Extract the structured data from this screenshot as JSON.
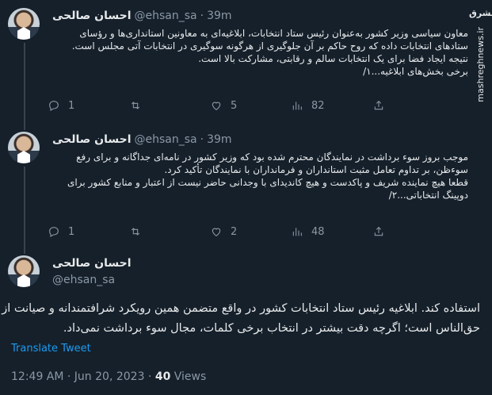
{
  "tweets": [
    {
      "name": "احسان صالحی",
      "handle": "@ehsan_sa",
      "dot": "·",
      "time": "39m",
      "lines": [
        "معاون سیاسی وزیر کشور به‌عنوان رئیس ستاد انتخابات، ابلاغیه‌ای به معاونین استانداری‌ها و رؤسای",
        "ستادهای انتخابات داده که روح حاکم بر آن جلوگیری از هرگونه سوگیری در انتخابات آتی مجلس است.",
        "نتیجه ایجاد فضا برای یک انتخابات سالم و رقابتی، مشارکت بالا است.",
        "برخی بخش‌های ابلاغیه...۱/"
      ],
      "replies": "1",
      "retweets": "",
      "likes": "5",
      "views": "82"
    },
    {
      "name": "احسان صالحی",
      "handle": "@ehsan_sa",
      "dot": "·",
      "time": "39m",
      "lines": [
        "موجب بروز سوء برداشت در نمایندگان محترم شده بود که وزیر کشور در نامه‌ای جداگانه و برای رفع",
        "سوءظن، بر تداوم تعامل مثبت استانداران و فرمانداران با نمایندگان تأکید کرد.",
        "قطعا هیچ نماینده شریف و پاکدست و هیچ کاندیدای با وجدانی حاضر نیست از اعتبار و منابع کشور برای",
        "دوپینگ انتخاباتی...۲/"
      ],
      "replies": "1",
      "retweets": "",
      "likes": "2",
      "views": "48"
    }
  ],
  "main": {
    "name": "احسان صالحی",
    "handle": "@ehsan_sa",
    "lines": [
      "استفاده کند. ابلاغیه رئیس ستاد انتخابات کشور در واقع متضمن همین رویکرد شرافتمندانه و صیانت از",
      "حق‌الناس است؛ اگرچه دقت بیشتر در انتخاب برخی کلمات، مجال سوء برداشت نمی‌داد."
    ],
    "translate": "Translate Tweet",
    "time": "12:49 AM · Jun 20, 2023 · ",
    "views_count": "40",
    "views_label": " Views"
  },
  "watermark": {
    "logo": "مشرق",
    "url": "mashreghnews.ir"
  },
  "colors": {
    "background": "#15202b",
    "text": "#e7e9ea",
    "muted": "#8b98a5",
    "accent": "#1d9bf0",
    "border": "#38444d"
  }
}
